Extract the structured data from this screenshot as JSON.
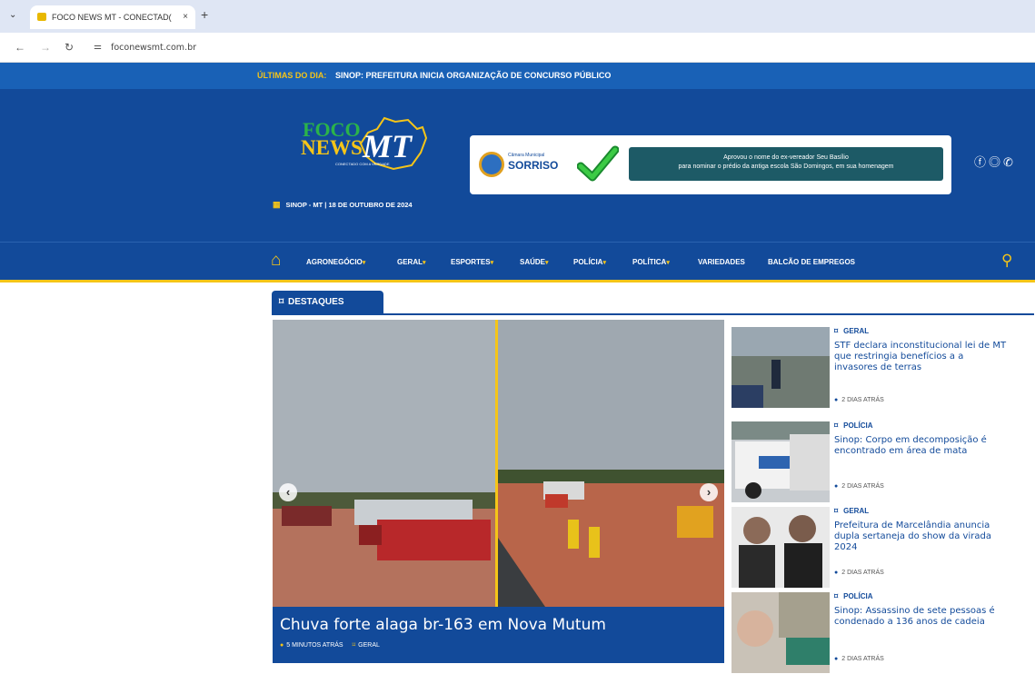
{
  "browser": {
    "tab_title": "FOCO NEWS MT - CONECTAD(",
    "tab_close": "×",
    "new_tab": "+",
    "url": "foconewsmt.com.br"
  },
  "ticker": {
    "label": "ÚLTIMAS DO DIA:",
    "text": "SINOP: PREFEITURA INICIA ORGANIZAÇÃO DE CONCURSO PÚBLICO"
  },
  "logo": {
    "foco": "FOCO",
    "news": "NEWS",
    "mt": "MT",
    "tagline": "CONECTADO COM A VERDADE"
  },
  "date_line": "SINOP - MT | 18 DE OUTUBRO DE 2024",
  "ad": {
    "camara": "Câmara Municipal",
    "sorriso": "SORRISO",
    "line1": "Aprovou o nome do ex-vereador Seu Basílio",
    "line2": "para nominar o prédio da antiga escola São Domingos, em sua homenagem"
  },
  "nav": {
    "items": [
      {
        "label": "AGRONEGÓCIO",
        "dropdown": true
      },
      {
        "label": "GERAL",
        "dropdown": true
      },
      {
        "label": "ESPORTES",
        "dropdown": true
      },
      {
        "label": "SAÚDE",
        "dropdown": true
      },
      {
        "label": "POLÍCIA",
        "dropdown": true
      },
      {
        "label": "POLÍTICA",
        "dropdown": true
      },
      {
        "label": "VARIEDADES",
        "dropdown": false
      },
      {
        "label": "BALCÃO DE EMPREGOS",
        "dropdown": false
      }
    ],
    "caret": "▾"
  },
  "destaques": {
    "label": "DESTAQUES"
  },
  "hero": {
    "title": "Chuva forte alaga br-163 em Nova Mutum",
    "time": "5 MINUTOS ATRÁS",
    "category": "GERAL"
  },
  "side": [
    {
      "category": "GERAL",
      "headline": "STF declara inconstitucional lei de MT que restringia benefícios a a invasores de terras",
      "time": "2 DIAS ATRÁS"
    },
    {
      "category": "POLÍCIA",
      "headline": "Sinop: Corpo em decomposição é encontrado em área de mata",
      "time": "2 DIAS ATRÁS"
    },
    {
      "category": "GERAL",
      "headline": "Prefeitura de Marcelândia anuncia dupla sertaneja do show da virada 2024",
      "time": "2 DIAS ATRÁS"
    },
    {
      "category": "POLÍCIA",
      "headline": "Sinop: Assassino de sete pessoas é condenado a 136 anos de cadeia",
      "time": "2 DIAS ATRÁS"
    }
  ],
  "colors": {
    "brand_blue": "#124a9a",
    "ticker_blue": "#1961b6",
    "accent_yellow": "#f5c518",
    "logo_green": "#2bb34a"
  }
}
